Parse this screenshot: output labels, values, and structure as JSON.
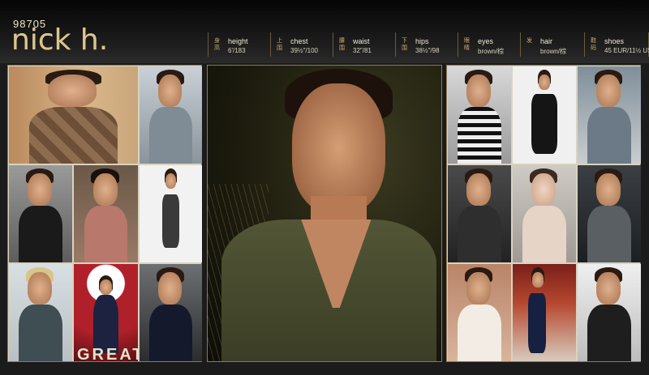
{
  "model": {
    "id": "98705",
    "name": "nick h."
  },
  "stats": [
    {
      "cn": "身高",
      "label": "height",
      "value": "6'/183"
    },
    {
      "cn": "上围",
      "label": "chest",
      "value": "39½\"/100"
    },
    {
      "cn": "腰围",
      "label": "waist",
      "value": "32\"/81"
    },
    {
      "cn": "下围",
      "label": "hips",
      "value": "38½\"/98"
    },
    {
      "cn": "眼睛",
      "label": "eyes",
      "value": "brown/棕"
    },
    {
      "cn": "发",
      "label": "hair",
      "value": "brown/棕"
    },
    {
      "cn": "鞋码",
      "label": "shoes",
      "value": "45 EUR/11½ US"
    }
  ],
  "left_grid_caption": "GREAT",
  "colors": {
    "gold": "#c9ad70",
    "border": "#8f7b4d",
    "background": "#1b1b1b"
  }
}
